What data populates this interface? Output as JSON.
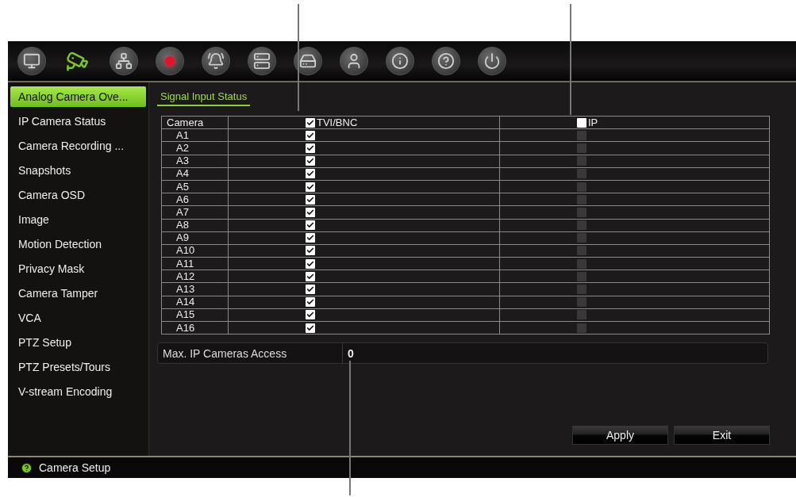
{
  "toolbar": [
    {
      "kind": "monitor",
      "selected": false
    },
    {
      "kind": "camera",
      "selected": true
    },
    {
      "kind": "network",
      "selected": false
    },
    {
      "kind": "record",
      "selected": false
    },
    {
      "kind": "alarm",
      "selected": false
    },
    {
      "kind": "device",
      "selected": false
    },
    {
      "kind": "disk",
      "selected": false
    },
    {
      "kind": "user",
      "selected": false
    },
    {
      "kind": "info",
      "selected": false
    },
    {
      "kind": "help",
      "selected": false
    },
    {
      "kind": "power",
      "selected": false
    }
  ],
  "sidebar": {
    "items": [
      {
        "label": "Analog Camera Ove...",
        "selected": true
      },
      {
        "label": "IP Camera Status",
        "selected": false
      },
      {
        "label": "Camera Recording ...",
        "selected": false
      },
      {
        "label": "Snapshots",
        "selected": false
      },
      {
        "label": "Camera OSD",
        "selected": false
      },
      {
        "label": "Image",
        "selected": false
      },
      {
        "label": "Motion Detection",
        "selected": false
      },
      {
        "label": "Privacy Mask",
        "selected": false
      },
      {
        "label": "Camera Tamper",
        "selected": false
      },
      {
        "label": "VCA",
        "selected": false
      },
      {
        "label": "PTZ Setup",
        "selected": false
      },
      {
        "label": "PTZ Presets/Tours",
        "selected": false
      },
      {
        "label": "V-stream Encoding",
        "selected": false
      }
    ]
  },
  "tabs": [
    {
      "label": "Signal Input Status",
      "selected": true
    }
  ],
  "table": {
    "columns": [
      {
        "label": "Camera"
      },
      {
        "label": "TVI/BNC",
        "checked": true
      },
      {
        "label": "IP",
        "checked": false
      }
    ],
    "rows": [
      {
        "camera": "A1",
        "tvi_checked": true,
        "ip_checked": false,
        "ip_disabled": true
      },
      {
        "camera": "A2",
        "tvi_checked": true,
        "ip_checked": false,
        "ip_disabled": true
      },
      {
        "camera": "A3",
        "tvi_checked": true,
        "ip_checked": false,
        "ip_disabled": true
      },
      {
        "camera": "A4",
        "tvi_checked": true,
        "ip_checked": false,
        "ip_disabled": true
      },
      {
        "camera": "A5",
        "tvi_checked": true,
        "ip_checked": false,
        "ip_disabled": true
      },
      {
        "camera": "A6",
        "tvi_checked": true,
        "ip_checked": false,
        "ip_disabled": true
      },
      {
        "camera": "A7",
        "tvi_checked": true,
        "ip_checked": false,
        "ip_disabled": true
      },
      {
        "camera": "A8",
        "tvi_checked": true,
        "ip_checked": false,
        "ip_disabled": true
      },
      {
        "camera": "A9",
        "tvi_checked": true,
        "ip_checked": false,
        "ip_disabled": true
      },
      {
        "camera": "A10",
        "tvi_checked": true,
        "ip_checked": false,
        "ip_disabled": true
      },
      {
        "camera": "A11",
        "tvi_checked": true,
        "ip_checked": false,
        "ip_disabled": true
      },
      {
        "camera": "A12",
        "tvi_checked": true,
        "ip_checked": false,
        "ip_disabled": true
      },
      {
        "camera": "A13",
        "tvi_checked": true,
        "ip_checked": false,
        "ip_disabled": true
      },
      {
        "camera": "A14",
        "tvi_checked": true,
        "ip_checked": false,
        "ip_disabled": true
      },
      {
        "camera": "A15",
        "tvi_checked": true,
        "ip_checked": false,
        "ip_disabled": true
      },
      {
        "camera": "A16",
        "tvi_checked": true,
        "ip_checked": false,
        "ip_disabled": true
      }
    ]
  },
  "max_ip_cameras": {
    "label": "Max. IP Cameras Access",
    "value": "0"
  },
  "buttons": [
    {
      "label": "Apply"
    },
    {
      "label": "Exit"
    }
  ],
  "status_bar": {
    "title": "Camera Setup"
  }
}
